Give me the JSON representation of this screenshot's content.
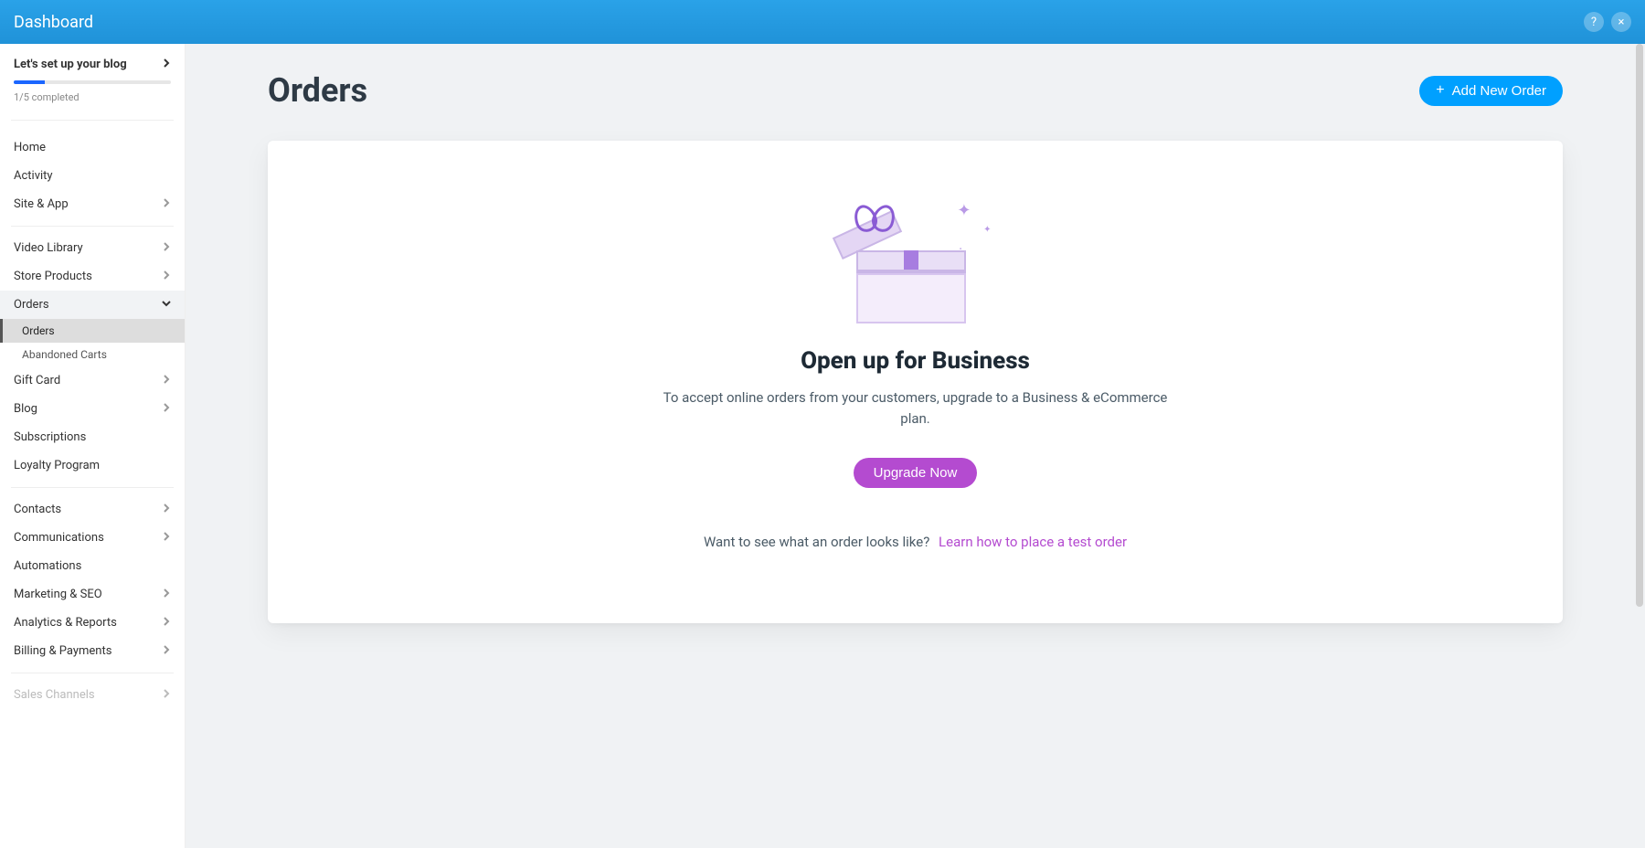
{
  "colors": {
    "topbar": "#2aa2e8",
    "primary_button": "#00a0ff",
    "upgrade_button": "#b44bd0",
    "link": "#b44bd0",
    "sidebar_active_bg": "#dddddd"
  },
  "topbar": {
    "title": "Dashboard",
    "help_icon": "?",
    "close_icon": "×"
  },
  "sidebar": {
    "setup": {
      "title": "Let's set up your blog",
      "progress_percent": 20,
      "completed_text": "1/5 completed"
    },
    "items": [
      {
        "label": "Home",
        "expandable": false
      },
      {
        "label": "Activity",
        "expandable": false
      },
      {
        "label": "Site & App",
        "expandable": true
      },
      {
        "divider": true
      },
      {
        "label": "Video Library",
        "expandable": true
      },
      {
        "label": "Store Products",
        "expandable": true
      },
      {
        "label": "Orders",
        "expandable": true,
        "expanded": true,
        "children": [
          {
            "label": "Orders",
            "active": true
          },
          {
            "label": "Abandoned Carts",
            "active": false
          }
        ]
      },
      {
        "label": "Gift Card",
        "expandable": true
      },
      {
        "label": "Blog",
        "expandable": true
      },
      {
        "label": "Subscriptions",
        "expandable": false
      },
      {
        "label": "Loyalty Program",
        "expandable": false
      },
      {
        "divider": true
      },
      {
        "label": "Contacts",
        "expandable": true
      },
      {
        "label": "Communications",
        "expandable": true
      },
      {
        "label": "Automations",
        "expandable": false
      },
      {
        "label": "Marketing & SEO",
        "expandable": true
      },
      {
        "label": "Analytics & Reports",
        "expandable": true
      },
      {
        "label": "Billing & Payments",
        "expandable": true
      },
      {
        "divider": true
      },
      {
        "label": "Sales Channels",
        "expandable": true,
        "faded": true
      }
    ]
  },
  "page": {
    "title": "Orders",
    "add_button": "Add New Order"
  },
  "empty_state": {
    "title": "Open up for Business",
    "description": "To accept online orders from your customers, upgrade to a Business & eCommerce plan.",
    "upgrade_button": "Upgrade Now",
    "test_order_prompt": "Want to see what an order looks like?",
    "test_order_link": "Learn how to place a test order"
  }
}
